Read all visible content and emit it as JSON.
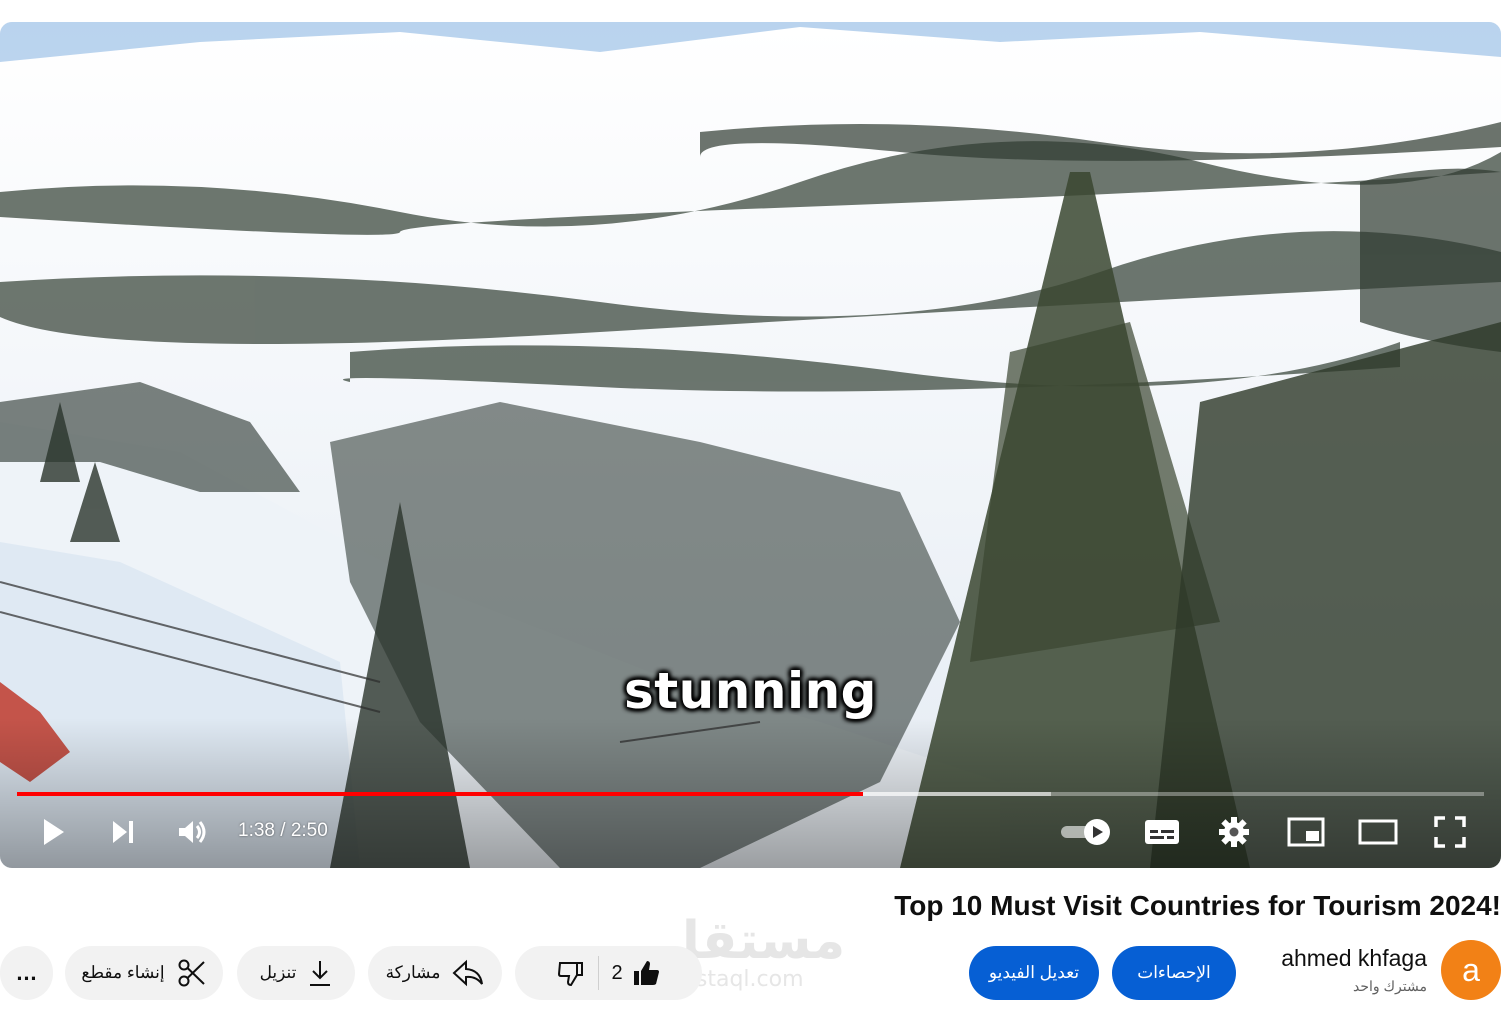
{
  "player": {
    "subtitle": "stunning",
    "current_time": "1:38",
    "duration": "2:50",
    "time_display": "1:38 / 2:50",
    "progress_fraction": 0.577,
    "buffered_fraction": 0.705,
    "icons": {
      "play": "play-icon",
      "next": "next-icon",
      "volume": "volume-icon",
      "autoplay": "autoplay-toggle-icon",
      "captions": "captions-icon",
      "settings": "gear-icon",
      "miniplayer": "miniplayer-icon",
      "theater": "theater-mode-icon",
      "fullscreen": "fullscreen-icon"
    },
    "accent_color": "#ff0000"
  },
  "video": {
    "title": "Top 10 Must Visit Countries for Tourism 2024!"
  },
  "channel": {
    "avatar_letter": "a",
    "name": "ahmed khfaga",
    "subscribers": "مشترك واحد"
  },
  "actions": {
    "stats_label": "الإحصاءات",
    "edit_video_label": "تعديل الفيديو",
    "like_count": "2",
    "share_label": "مشاركة",
    "download_label": "تنزيل",
    "clip_label": "إنشاء مقطع",
    "more_label": "…",
    "brand_color": "#065fd4"
  },
  "watermark": {
    "text_ar": "مستقل",
    "text_en": "mostaql.com"
  }
}
